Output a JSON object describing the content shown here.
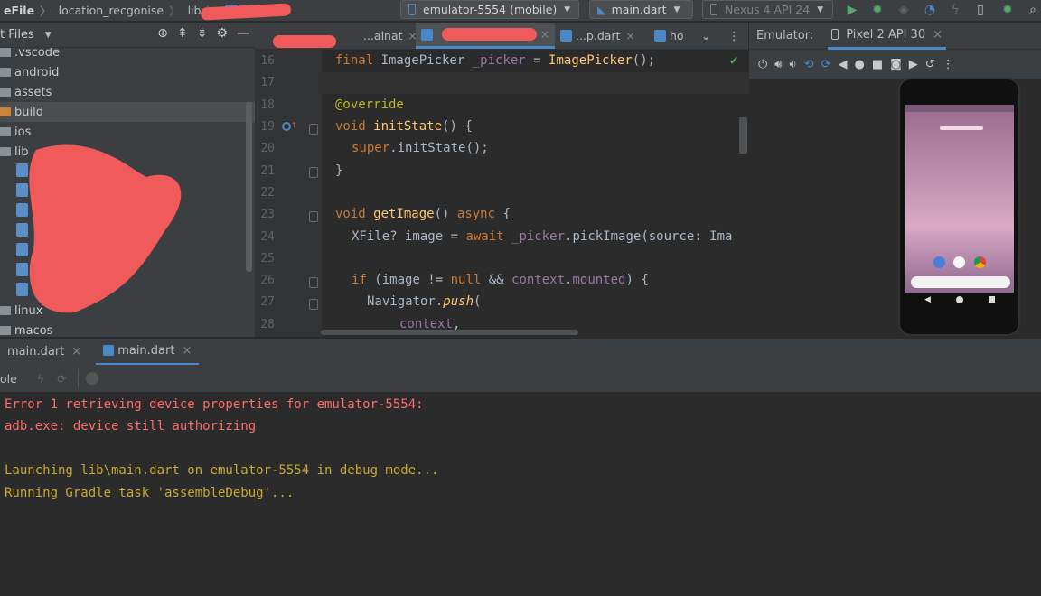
{
  "breadcrumb": {
    "project": "eFile",
    "folder": "location_recgonise",
    "lib": "lib"
  },
  "toolbar": {
    "device_selector": "emulator-5554 (mobile)",
    "run_config": "main.dart",
    "avd_selector": "Nexus 4 API 24"
  },
  "project_panel": {
    "title": "t Files",
    "items": [
      {
        "label": ".vscode",
        "type": "folder"
      },
      {
        "label": "android",
        "type": "folder"
      },
      {
        "label": "assets",
        "type": "folder"
      },
      {
        "label": "build",
        "type": "folder-orange",
        "selected": true
      },
      {
        "label": "ios",
        "type": "folder"
      },
      {
        "label": "lib",
        "type": "folder"
      },
      {
        "label": "linux",
        "type": "folder"
      },
      {
        "label": "macos",
        "type": "folder"
      }
    ]
  },
  "editor": {
    "tabs": [
      {
        "label": "...ainat",
        "active": false
      },
      {
        "label": "",
        "active": true
      },
      {
        "label": "...p.dart",
        "active": false
      },
      {
        "label": "ho",
        "active": false
      }
    ],
    "lines": [
      {
        "n": "16"
      },
      {
        "n": "17"
      },
      {
        "n": "18"
      },
      {
        "n": "19"
      },
      {
        "n": "20"
      },
      {
        "n": "21"
      },
      {
        "n": "22"
      },
      {
        "n": "23"
      },
      {
        "n": "24"
      },
      {
        "n": "25"
      },
      {
        "n": "26"
      },
      {
        "n": "27"
      },
      {
        "n": "28"
      }
    ],
    "code": {
      "l16_a": "final ",
      "l16_b": "ImagePicker ",
      "l16_c": "_picker",
      "l16_d": " = ",
      "l16_e": "ImagePicker",
      "l16_f": "();",
      "l18": "@override",
      "l19_a": "void ",
      "l19_b": "initState",
      "l19_c": "() {",
      "l20_a": "super",
      "l20_b": ".initState();",
      "l21": "}",
      "l23_a": "void ",
      "l23_b": "getImage",
      "l23_c": "() ",
      "l23_d": "async",
      "l23_e": " {",
      "l24_a": "XFile? image = ",
      "l24_b": "await ",
      "l24_c": "_picker",
      "l24_d": ".pickImage(source: Ima",
      "l26_a": "if ",
      "l26_b": "(image != ",
      "l26_c": "null",
      "l26_d": " && ",
      "l26_e": "context",
      "l26_f": ".",
      "l26_g": "mounted",
      "l26_h": ") {",
      "l27_a": "Navigator",
      "l27_b": ".",
      "l27_c": "push",
      "l27_d": "(",
      "l28_a": "context",
      "l28_b": ","
    }
  },
  "emulator": {
    "label": "Emulator:",
    "device_tab": "Pixel 2 API 30"
  },
  "run_panel": {
    "tabs": [
      {
        "label": "main.dart"
      },
      {
        "label": "main.dart"
      }
    ],
    "console_label": "ole",
    "lines": [
      {
        "text": "Error 1 retrieving device properties for emulator-5554:",
        "kind": "error"
      },
      {
        "text": "adb.exe: device still authorizing",
        "kind": "error"
      },
      {
        "text": "Launching lib\\main.dart on emulator-5554 in debug mode...",
        "kind": "info"
      },
      {
        "text": "Running Gradle task 'assembleDebug'...",
        "kind": "info"
      }
    ]
  },
  "colors": {
    "accent": "#4a88c7",
    "error": "#ff6b68",
    "info": "#c9a82f",
    "redaction": "#f05a5a"
  }
}
